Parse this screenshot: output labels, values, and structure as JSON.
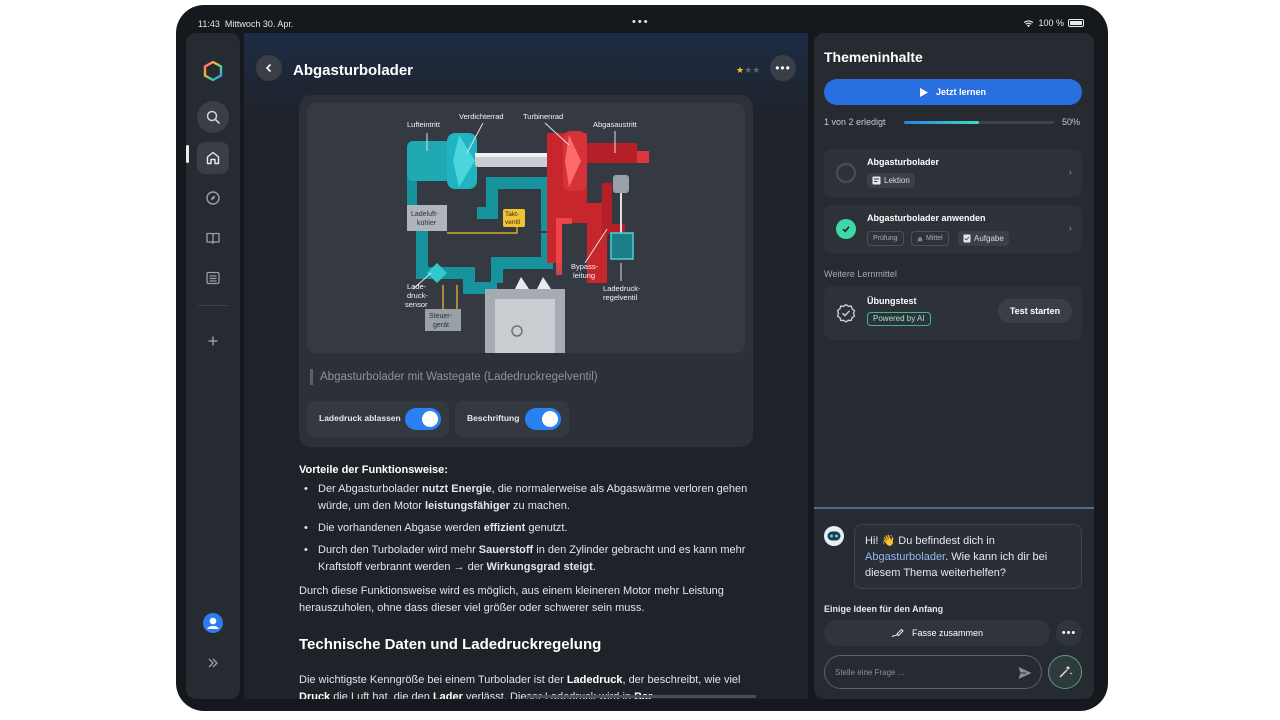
{
  "status_bar": {
    "time": "11:43",
    "date": "Mittwoch 30. Apr.",
    "battery": "100 %"
  },
  "header": {
    "title": "Abgasturbolader"
  },
  "figure": {
    "labels": {
      "lufteintritt": "Lufteintritt",
      "verdichterrad": "Verdichterrad",
      "turbinenrad": "Turbinenrad",
      "abgasaustritt": "Abgasaustritt",
      "ladeluftkuehler_1": "Ladeluft-",
      "ladeluftkuehler_2": "kühler",
      "taktventil_1": "Takt-",
      "taktventil_2": "ventil",
      "bypass_1": "Bypass-",
      "bypass_2": "leitung",
      "sensor_1": "Lade-",
      "sensor_2": "druck-",
      "sensor_3": "sensor",
      "regelventil_1": "Ladedruck-",
      "regelventil_2": "regelventil",
      "steuergeraet_1": "Steuer-",
      "steuergeraet_2": "gerät"
    },
    "caption": "Abgasturbolader mit Wastegate (Ladedruckregelventil)",
    "toggles": [
      {
        "label": "Ladedruck ablassen",
        "on": true
      },
      {
        "label": "Beschriftung",
        "on": true
      }
    ]
  },
  "content": {
    "advantages_heading": "Vorteile der Funktionsweise:",
    "bullets": [
      {
        "parts": [
          "Der Abgasturbolader ",
          "nutzt Energie",
          ", die normalerweise als Abgaswärme verloren gehen würde, um den Motor ",
          "leistungsfähiger",
          " zu machen."
        ]
      },
      {
        "parts": [
          "Die vorhandenen Abgase werden ",
          "effizient",
          " genutzt."
        ]
      },
      {
        "parts": [
          "Durch den Turbolader wird mehr ",
          "Sauerstoff",
          " in den Zylinder gebracht und es kann mehr Kraftstoff verbrannt werden → der ",
          "Wirkungsgrad steigt",
          "."
        ]
      }
    ],
    "summary": "Durch diese Funktionsweise wird es möglich, aus einem kleineren Motor mehr Leistung herauszuholen, ohne dass dieser viel größer oder schwerer sein muss.",
    "section_title": "Technische Daten und Ladedruckregelung",
    "tech_parts": [
      "Die wichtigste Kenngröße bei einem Turbolader ist der ",
      "Ladedruck",
      ", der beschreibt, wie viel ",
      "Druck",
      " die Luft hat, die den ",
      "Lader",
      " verlässt. Dieser Ladedruck wird in ",
      "Bar"
    ]
  },
  "panel": {
    "title": "Themeninhalte",
    "learn_button": "Jetzt lernen",
    "progress_text": "1 von 2 erledigt",
    "progress_fraction": 0.5,
    "progress_pct": "50%",
    "items": [
      {
        "title": "Abgasturbolader",
        "done": false,
        "chips": [
          "Lektion"
        ]
      },
      {
        "title": "Abgasturbolader anwenden",
        "done": true,
        "chips": [
          "Prüfung",
          "Mittel",
          "Aufgabe"
        ]
      }
    ],
    "more_label": "Weitere Lernmittel",
    "test": {
      "title": "Übungstest",
      "badge": "Powered by AI",
      "button": "Test starten"
    },
    "chat": {
      "greeting_1": "Hi! 👋 Du befindest dich in",
      "greeting_link": "Abgasturbolader",
      "greeting_2": ". Wie kann ich dir bei diesem Thema weiterhelfen?",
      "ideas_label": "Einige Ideen für den Anfang",
      "idea_button": "Fasse zusammen",
      "input_placeholder": "Stelle eine Frage ..."
    }
  },
  "colors": {
    "accent": "#2a6fe0",
    "success": "#3fd7a8",
    "air": "#1fa9b3",
    "exhaust": "#c8262d",
    "rating_star": "#f2c230"
  },
  "rating": {
    "filled": 1,
    "max": 3
  },
  "icons": [
    "app-logo-icon",
    "search-icon",
    "home-icon",
    "compass-icon",
    "book-icon",
    "list-icon",
    "plus-icon",
    "user-avatar-icon",
    "expand-icon"
  ]
}
